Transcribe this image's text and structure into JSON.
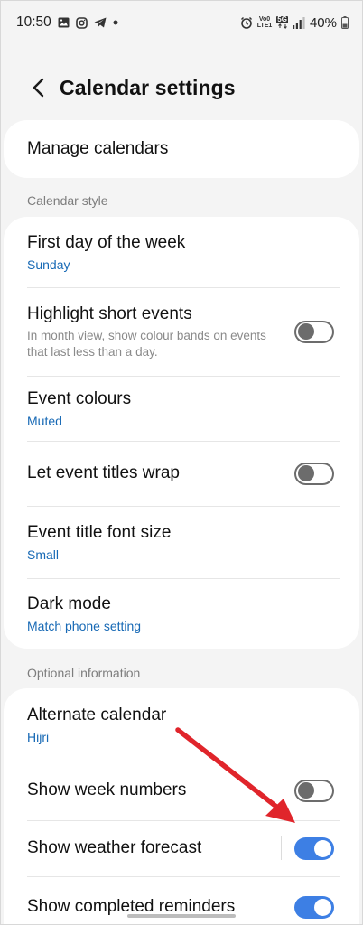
{
  "status_bar": {
    "time": "10:50",
    "left_icons": [
      "gallery-icon",
      "instagram-icon",
      "telegram-icon",
      "dot-icon"
    ],
    "right_icons": [
      "alarm-icon",
      "volte-icon",
      "5g-icon",
      "signal-icon"
    ],
    "volte_text": "Vo0\nLTE1",
    "network_text": "5G",
    "battery": "40%"
  },
  "header": {
    "title": "Calendar settings",
    "back_icon": "chevron-left-icon"
  },
  "manage": {
    "label": "Manage calendars"
  },
  "calendar_style": {
    "label": "Calendar style",
    "items": [
      {
        "title": "First day of the week",
        "value": "Sunday"
      },
      {
        "title": "Highlight short events",
        "description": "In month view, show colour bands on events that last less than a day.",
        "toggle": false
      },
      {
        "title": "Event colours",
        "value": "Muted"
      },
      {
        "title": "Let event titles wrap",
        "toggle": false
      },
      {
        "title": "Event title font size",
        "value": "Small"
      },
      {
        "title": "Dark mode",
        "value": "Match phone setting"
      }
    ]
  },
  "optional_information": {
    "label": "Optional information",
    "items": [
      {
        "title": "Alternate calendar",
        "value": "Hijri"
      },
      {
        "title": "Show week numbers",
        "toggle": false
      },
      {
        "title": "Show weather forecast",
        "toggle": true
      },
      {
        "title": "Show completed reminders",
        "toggle": true
      }
    ]
  },
  "colors": {
    "accent_blue": "#3d7fe4",
    "value_blue": "#1769b5",
    "annotation_red": "#e0252b",
    "background": "#f4f4f4"
  }
}
